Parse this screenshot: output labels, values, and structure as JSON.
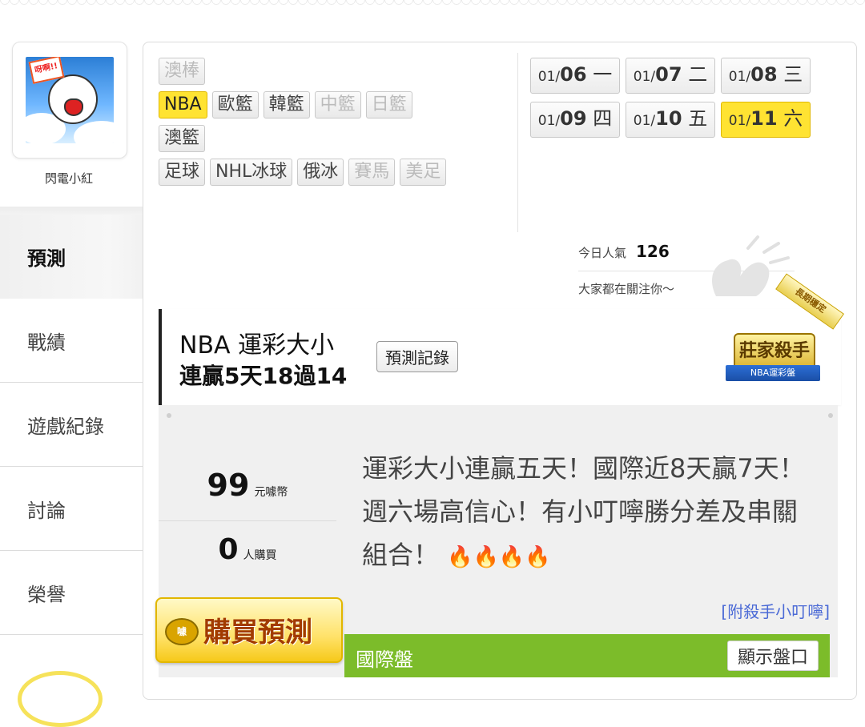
{
  "profile": {
    "avatar_caption": "呀啊!!",
    "username": "閃電小紅"
  },
  "nav": {
    "items": [
      {
        "label": "預測",
        "active": true
      },
      {
        "label": "戰績",
        "active": false
      },
      {
        "label": "遊戲紀錄",
        "active": false
      },
      {
        "label": "討論",
        "active": false
      },
      {
        "label": "榮譽",
        "active": false
      }
    ]
  },
  "sports": {
    "rows": [
      [
        {
          "label": "澳棒",
          "state": "disabled"
        }
      ],
      [
        {
          "label": "NBA",
          "state": "active"
        },
        {
          "label": "歐籃",
          "state": "normal"
        },
        {
          "label": "韓籃",
          "state": "normal"
        },
        {
          "label": "中籃",
          "state": "disabled"
        },
        {
          "label": "日籃",
          "state": "disabled"
        }
      ],
      [
        {
          "label": "澳籃",
          "state": "normal"
        }
      ],
      [
        {
          "label": "足球",
          "state": "normal"
        },
        {
          "label": "NHL冰球",
          "state": "normal"
        },
        {
          "label": "俄冰",
          "state": "normal"
        },
        {
          "label": "賽馬",
          "state": "disabled"
        },
        {
          "label": "美足",
          "state": "disabled"
        }
      ]
    ]
  },
  "dates": [
    {
      "month": "01/",
      "day": "06",
      "weekday": "一",
      "active": false
    },
    {
      "month": "01/",
      "day": "07",
      "weekday": "二",
      "active": false
    },
    {
      "month": "01/",
      "day": "08",
      "weekday": "三",
      "active": false
    },
    {
      "month": "01/",
      "day": "09",
      "weekday": "四",
      "active": false
    },
    {
      "month": "01/",
      "day": "10",
      "weekday": "五",
      "active": false
    },
    {
      "month": "01/",
      "day": "11",
      "weekday": "六",
      "active": true
    }
  ],
  "popularity": {
    "label": "今日人氣",
    "value": "126",
    "subtext": "大家都在關注你～"
  },
  "prediction": {
    "title": "NBA 運彩大小",
    "streak": "連贏5天18過14",
    "history_button": "預測記錄",
    "badge_ribbon": "長期穩定",
    "badge_title": "莊家殺手",
    "badge_band": "NBA運彩盤"
  },
  "offer": {
    "price": "99",
    "price_unit": "元噱幣",
    "buyers": "0",
    "buyers_unit": "人購買",
    "description": "運彩大小連贏五天！國際近8天贏7天！週六場高信心！有小叮嚀勝分差及串關組合！",
    "flames": "🔥🔥🔥🔥",
    "attachment": "[附殺手小叮嚀]",
    "buy_coin": "噱",
    "buy_button": "購買預測"
  },
  "market": {
    "label": "國際盤",
    "show_button": "顯示盤口"
  },
  "colors": {
    "active_yellow": "#ffe332",
    "market_green": "#7cbc2a",
    "link_blue": "#4b6ad6"
  }
}
